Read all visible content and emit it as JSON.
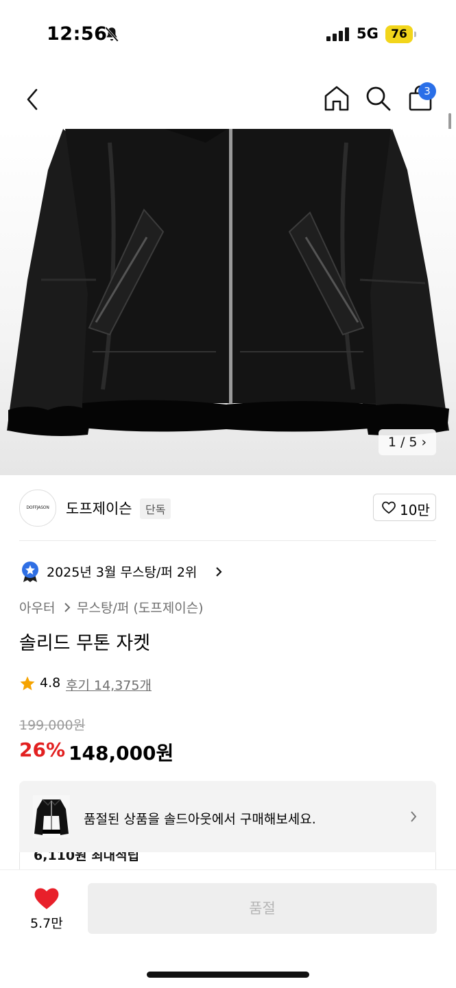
{
  "status_bar": {
    "time": "12:56",
    "network": "5G",
    "battery": "76",
    "battery_color": "#f2d51b"
  },
  "nav": {
    "cart_count": "3",
    "badge_color": "#2a6fe8"
  },
  "gallery": {
    "counter": "1 / 5"
  },
  "brand": {
    "logo_text": "DOFFJASON",
    "name": "도프제이슨",
    "tag": "단독",
    "likes": "10만"
  },
  "ranking": {
    "text": "2025년 3월 무스탕/퍼 2위"
  },
  "category": {
    "level1": "아우터",
    "level2": "무스탕/퍼 (도프제이슨)"
  },
  "product": {
    "title": "솔리드 무톤 자켓",
    "rating": "4.8",
    "reviews": "후기 14,375개",
    "original_price": "199,000원",
    "discount": "26%",
    "price": "148,000원",
    "discount_color": "#e22020"
  },
  "banner": {
    "text": "품절된 상품을 솔드아웃에서 구매해보세요."
  },
  "reward": {
    "text": "6,110원 최대적립"
  },
  "bottom": {
    "wish_count": "5.7만",
    "action_label": "품절",
    "heart_color": "#e8202a"
  }
}
